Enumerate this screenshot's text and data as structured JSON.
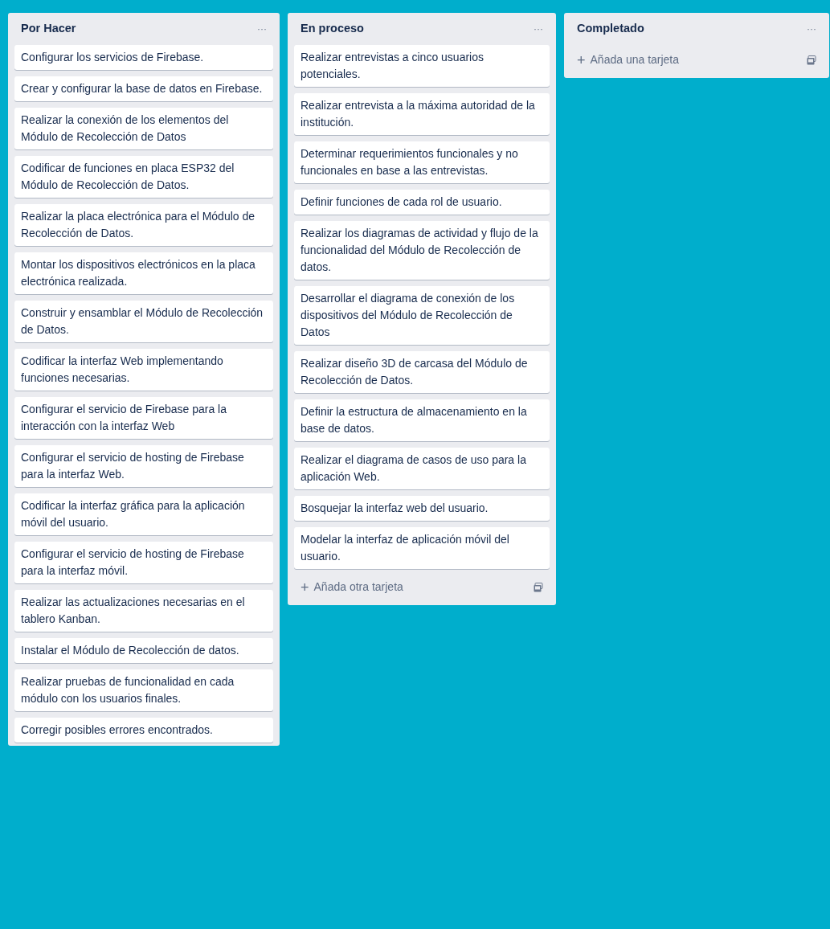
{
  "lists": [
    {
      "title": "Por Hacer",
      "menu": "···",
      "cards": [
        "Configurar los servicios de Firebase.",
        "Crear y configurar la base de datos en Firebase.",
        "Realizar la conexión de los elementos del Módulo de Recolección de Datos",
        "Codificar de funciones en placa ESP32 del Módulo de Recolección de Datos.",
        "Realizar la placa electrónica para el Módulo de Recolección de Datos.",
        "Montar los dispositivos electrónicos en la placa electrónica realizada.",
        "Construir y ensamblar el Módulo de Recolección de Datos.",
        "Codificar la interfaz Web implementando funciones necesarias.",
        "Configurar el servicio de Firebase para la interacción con la interfaz Web",
        "Configurar el servicio de hosting de Firebase para la interfaz Web.",
        "Codificar la interfaz gráfica para la aplicación móvil del usuario.",
        "Configurar el servicio de hosting de Firebase para la interfaz móvil.",
        "Realizar las actualizaciones necesarias en el tablero Kanban.",
        "Instalar el Módulo de Recolección de datos.",
        "Realizar pruebas de funcionalidad en cada módulo con los usuarios finales.",
        "Corregir posibles errores encontrados."
      ]
    },
    {
      "title": "En proceso",
      "menu": "···",
      "cards": [
        "Realizar entrevistas a cinco usuarios potenciales.",
        "Realizar entrevista a la máxima autoridad de la institución.",
        "Determinar requerimientos funcionales y no funcionales en base a las entrevistas.",
        "Definir funciones de cada rol de usuario.",
        "Realizar los diagramas de actividad y flujo de la funcionalidad del Módulo de Recolección de datos.",
        "Desarrollar el diagrama de conexión de los dispositivos del Módulo de Recolección de Datos",
        "Realizar diseño 3D de carcasa del Módulo de Recolección de Datos.",
        "Definir la estructura de almacenamiento en la base de datos.",
        "Realizar el diagrama de casos de uso para la aplicación Web.",
        "Bosquejar la interfaz web del usuario.",
        "Modelar la interfaz de aplicación móvil del usuario."
      ],
      "add_card": {
        "plus": "+",
        "label": "Añada otra tarjeta"
      }
    },
    {
      "title": "Completado",
      "menu": "···",
      "add_card": {
        "plus": "+",
        "label": "Añada una tarjeta"
      }
    }
  ]
}
